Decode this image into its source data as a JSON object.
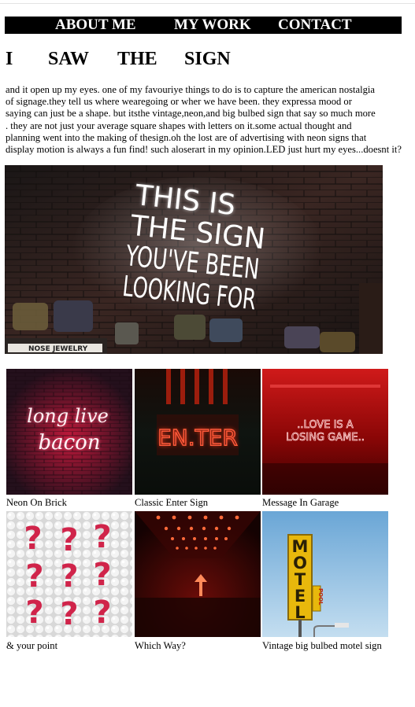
{
  "nav": {
    "items": [
      {
        "label": "ABOUT ME"
      },
      {
        "label": "MY WORK"
      },
      {
        "label": "CONTACT"
      }
    ]
  },
  "heading": {
    "words": [
      "I",
      "SAW",
      "THE",
      "SIGN"
    ]
  },
  "intro": {
    "lines": [
      "and it open up my eyes. one of my favouriye things to do is to capture the american nostalgia",
      "of signage.they tell us where wearegoing or wher we have been. they expressa mood or",
      "saying can just be a shape. but itsthe vintage,neon,and big bulbed sign that say so much more",
      ". they are not just your average square shapes with letters on it.some actual thought and",
      "planning went into the making of thesign.oh the lost are of advertising with neon signs that",
      "display motion is always a fun find! such aloserart in my opinion.LED just hurt my eyes...doesnt it?"
    ]
  },
  "hero": {
    "sign_lines": [
      "THIS IS",
      "THE SIGN",
      "YOU'VE BEEN",
      "LOOKING FOR"
    ],
    "shelf_label": "NOSE JEWELRY"
  },
  "gallery": {
    "items": [
      {
        "caption": "Neon On Brick",
        "sign_text": [
          "long live",
          "bacon"
        ]
      },
      {
        "caption": "Classic Enter Sign",
        "sign_text": "EN.TER"
      },
      {
        "caption": "Message In Garage",
        "sign_text": [
          "..LOVE IS A",
          "LOSING GAME.."
        ]
      },
      {
        "caption": "& your point",
        "sign_text": "?"
      },
      {
        "caption": "Which Way?",
        "sign_text": ""
      },
      {
        "caption": "Vintage big bulbed motel sign",
        "sign_text": [
          "MOTEL",
          "POOL"
        ]
      }
    ]
  },
  "colors": {
    "nav_bg": "#000000",
    "neon_white": "#ffffff",
    "neon_red": "#ff2a2a",
    "sky_blue": "#8ebde0",
    "motel_yellow": "#e8b80c"
  }
}
